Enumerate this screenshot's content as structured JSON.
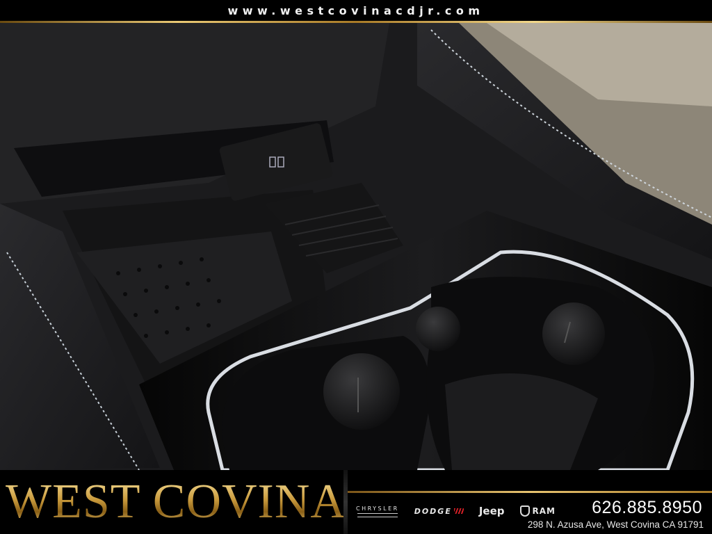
{
  "banner": {
    "url": "www.westcovinacdjr.com"
  },
  "photo": {
    "subject": "vehicle center console with storage tray, USB ports and cupholders"
  },
  "footer": {
    "wordmark": "WEST COVINA",
    "brands": [
      "CHRYSLER",
      "DODGE",
      "Jeep",
      "RAM"
    ],
    "phone": "626.885.8950",
    "address": "298 N. Azusa Ave, West Covina CA 91791"
  },
  "colors": {
    "gold": "#c99a3c",
    "dodge_red": "#d21f26",
    "banner_bg": "#000000"
  },
  "icons": [
    "usb-port-icon",
    "ram-head-icon"
  ]
}
